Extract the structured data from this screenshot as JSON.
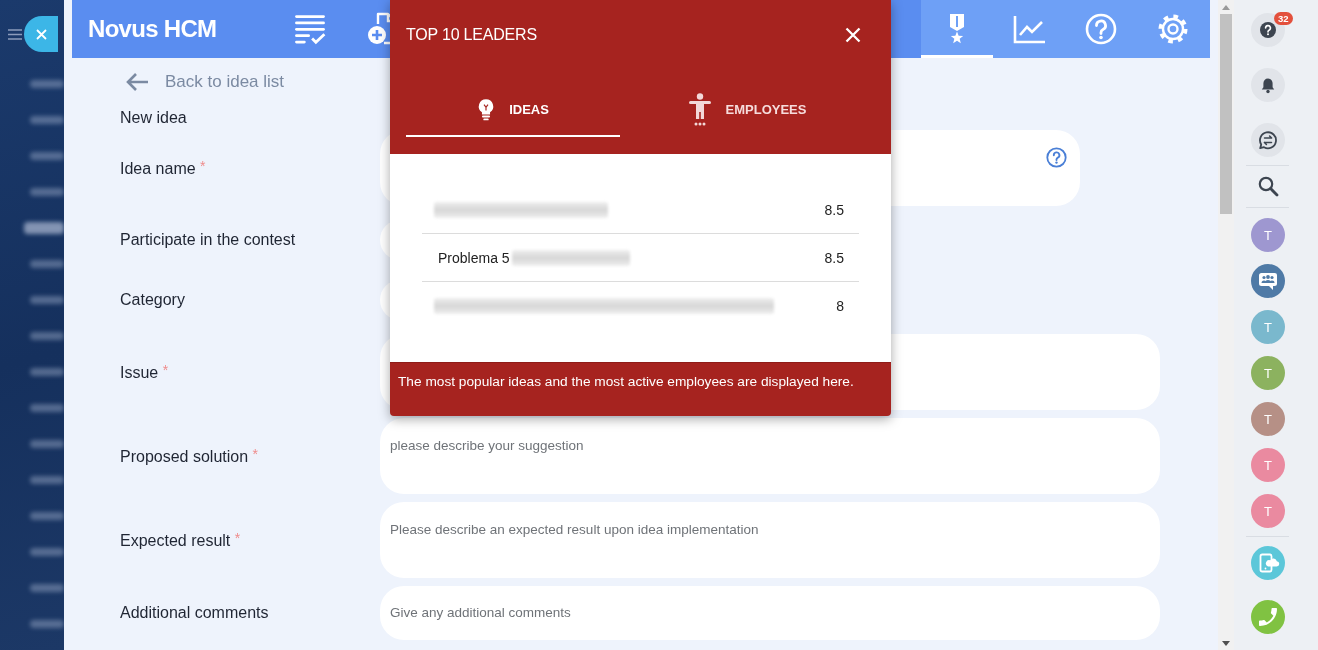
{
  "header": {
    "app_name": "Novus HCM",
    "nav_left": [
      {
        "kind": "task-list",
        "selected": false
      },
      {
        "kind": "add-document",
        "selected": false
      }
    ],
    "nav_right": [
      {
        "kind": "medal",
        "selected": true
      },
      {
        "kind": "chart",
        "selected": false
      },
      {
        "kind": "help",
        "selected": false
      },
      {
        "kind": "settings",
        "selected": false
      }
    ]
  },
  "form": {
    "back_link": "Back to idea list",
    "heading": "New idea",
    "fields": [
      {
        "label": "Idea name",
        "required_mark": "*",
        "kind": "text",
        "help": true
      },
      {
        "label": "Participate in the contest",
        "kind": "short"
      },
      {
        "label": "Category",
        "kind": "short"
      },
      {
        "label": "Issue",
        "required_mark": "*",
        "kind": "textarea"
      },
      {
        "label": "Proposed solution",
        "required_mark": "*",
        "kind": "textarea",
        "placeholder": "please describe your suggestion"
      },
      {
        "label": "Expected result",
        "required_mark": "*",
        "kind": "textarea",
        "placeholder": "Please describe an expected result upon idea implementation"
      },
      {
        "label": "Additional comments",
        "kind": "compact",
        "placeholder": "Give any additional comments"
      }
    ]
  },
  "popup": {
    "title": "TOP 10 LEADERS",
    "tabs": [
      {
        "kind": "ideas",
        "label": "IDEAS",
        "selected": true
      },
      {
        "kind": "employees",
        "label": "EMPLOYEES",
        "selected": false
      }
    ],
    "rows": [
      {
        "redacted": true,
        "score": "8.5"
      },
      {
        "name": "Problema 5",
        "redacted": true,
        "score": "8.5"
      },
      {
        "redacted": true,
        "score": "8"
      }
    ],
    "footer": "The most popular ideas and the most active employees are displayed here."
  },
  "sidebar": {
    "groups": [
      {
        "kind": "tools",
        "items": [
          {
            "kind": "help",
            "badge": "32"
          },
          {
            "kind": "bell"
          },
          {
            "kind": "chat-sync"
          }
        ]
      },
      {
        "kind": "search",
        "items": [
          {
            "kind": "search"
          }
        ]
      },
      {
        "kind": "contacts",
        "items": [
          {
            "kind": "avatar",
            "initial": "T",
            "color": "#9e97d0"
          },
          {
            "kind": "group-chat"
          },
          {
            "kind": "avatar",
            "initial": "T",
            "color": "#7ab8cd"
          },
          {
            "kind": "avatar",
            "initial": "T",
            "color": "#8cb25f"
          },
          {
            "kind": "avatar",
            "initial": "T",
            "color": "#b69086"
          },
          {
            "kind": "avatar",
            "initial": "T",
            "color": "#ea8aa0"
          },
          {
            "kind": "avatar",
            "initial": "T",
            "color": "#ea8aa0"
          }
        ]
      },
      {
        "kind": "calls",
        "items": [
          {
            "kind": "cloud-phone"
          },
          {
            "kind": "call"
          }
        ]
      }
    ]
  }
}
